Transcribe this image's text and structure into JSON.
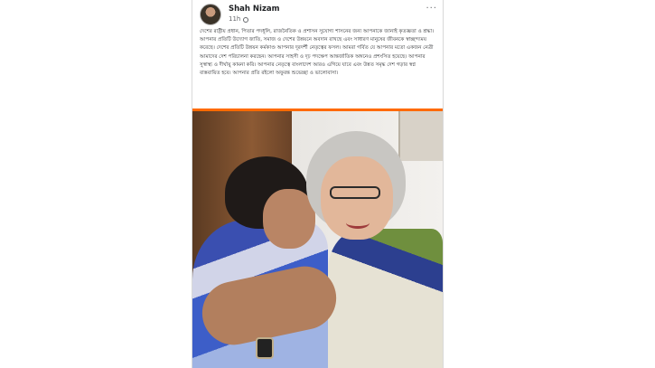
{
  "post": {
    "author_name": "Shah Nizam",
    "timestamp": "11h",
    "privacy_icon": "globe-icon",
    "more_icon": "more-options-icon",
    "body_text": "দেশের রাষ্ট্রীয় প্রধান, পিতার পদধূলি, রাজনৈতিক ও প্রশাসন সুযোগ্য শাসনের জন্য আপনাকে জানাই কৃতজ্ঞতা ও শ্রদ্ধা। আপনার প্রতিটি উদ্যোগ জাতি, সমাজ ও দেশের উন্নয়নে অবদান রাখছে এবং সাধারণ মানুষের জীবনকে স্বাচ্ছন্দ্যময় করেছে। দেশের প্রতিটি উন্নয়ন কর্মকাণ্ড আপনার দূরদর্শী নেতৃত্বের ফসল। আমরা গর্বিত যে আপনার মতো একজন নেত্রী আমাদের দেশ পরিচালনা করছেন। আপনার সাহসী ও দৃঢ় পদক্ষেপ আন্তর্জাতিক অঙ্গনেও প্রশংসিত হয়েছে। আপনার সুস্বাস্থ্য ও দীর্ঘায়ু কামনা করি। আপনার নেতৃত্বে বাংলাদেশ আরও এগিয়ে যাবে এবং উন্নত সমৃদ্ধ দেশ গড়ার স্বপ্ন বাস্তবায়িত হবে। আপনার প্রতি রইলো অফুরন্ত শুভেচ্ছা ও ভালোবাসা।"
  },
  "photo": {
    "description_icon": "photo-hug"
  },
  "colors": {
    "accent_divider": "#ff6a00"
  }
}
